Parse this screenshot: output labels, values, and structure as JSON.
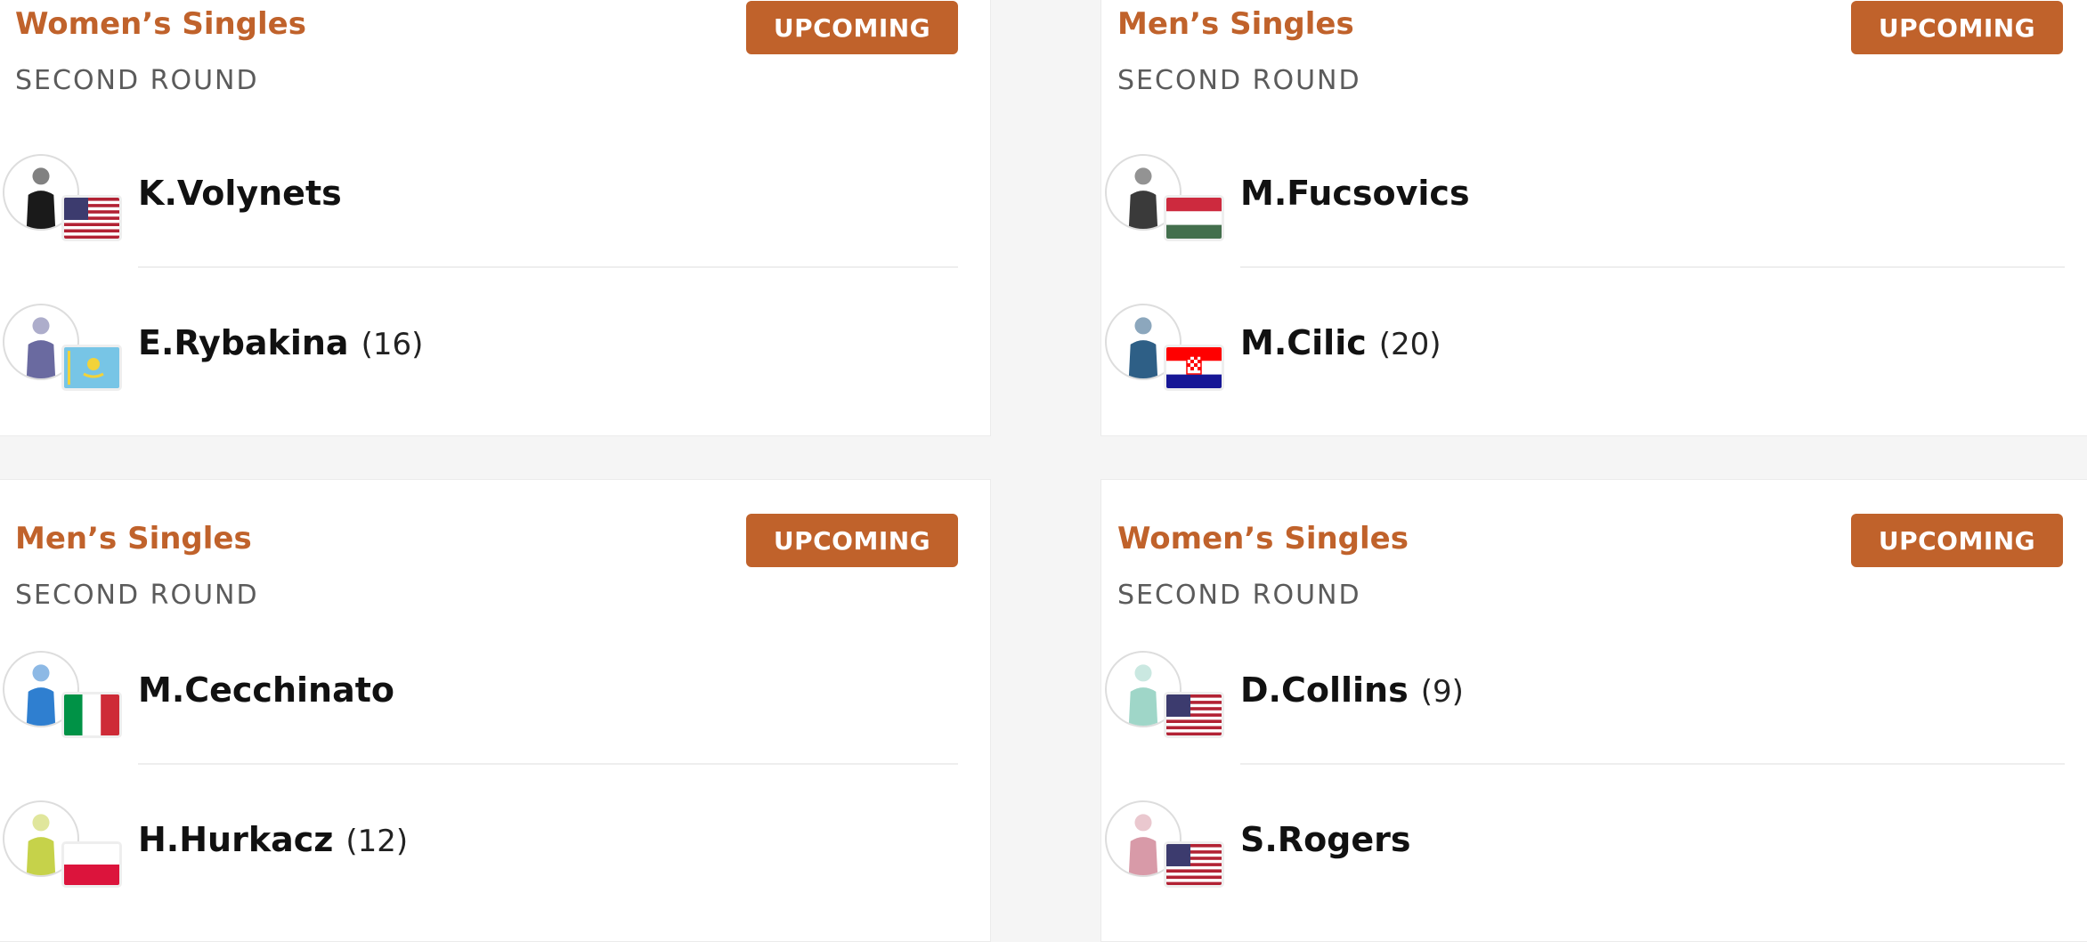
{
  "matches": [
    {
      "event": "Women’s Singles",
      "round": "SECOND ROUND",
      "status": "UPCOMING",
      "players": [
        {
          "name": "K.Volynets",
          "seed": "",
          "flag": "us-flag"
        },
        {
          "name": "E.Rybakina",
          "seed": "(16)",
          "flag": "kz-flag"
        }
      ]
    },
    {
      "event": "Men’s Singles",
      "round": "SECOND ROUND",
      "status": "UPCOMING",
      "players": [
        {
          "name": "M.Fucsovics",
          "seed": "",
          "flag": "hu-flag"
        },
        {
          "name": "M.Cilic",
          "seed": "(20)",
          "flag": "hr-flag"
        }
      ]
    },
    {
      "event": "Men’s Singles",
      "round": "SECOND ROUND",
      "status": "UPCOMING",
      "players": [
        {
          "name": "M.Cecchinato",
          "seed": "",
          "flag": "it-flag"
        },
        {
          "name": "H.Hurkacz",
          "seed": "(12)",
          "flag": "pl-flag"
        }
      ]
    },
    {
      "event": "Women’s Singles",
      "round": "SECOND ROUND",
      "status": "UPCOMING",
      "players": [
        {
          "name": "D.Collins",
          "seed": "(9)",
          "flag": "us-flag"
        },
        {
          "name": "S.Rogers",
          "seed": "",
          "flag": "us-flag"
        }
      ]
    }
  ],
  "colors": {
    "accent": "#c0622b",
    "round_text": "#5b5b5b",
    "name_text": "#111111"
  }
}
